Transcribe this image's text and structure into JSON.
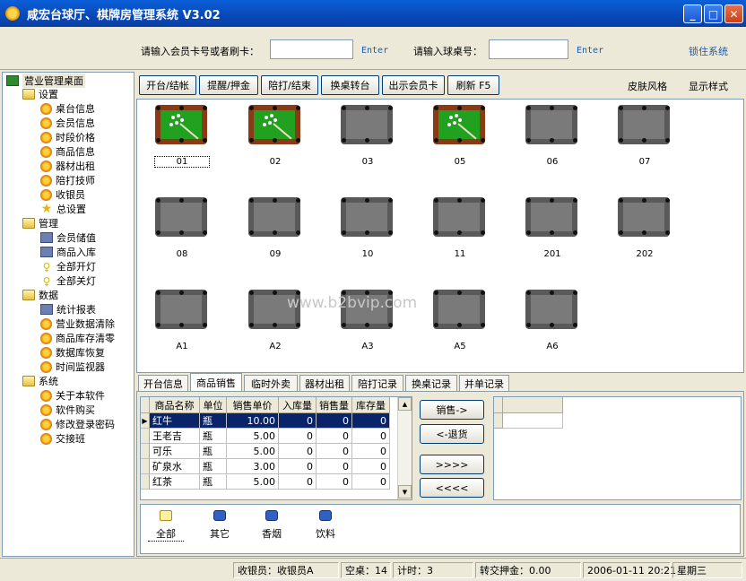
{
  "window": {
    "title": "咸宏台球厅、棋牌房管理系统 V3.02",
    "min": "_",
    "max": "□",
    "close": "✕"
  },
  "topbar": {
    "card_label": "请输入会员卡号或者刷卡：",
    "card_value": "",
    "enter1": "Enter",
    "table_label": "请输入球桌号：",
    "table_value": "",
    "enter2": "Enter",
    "lock": "锁住系统"
  },
  "tree": {
    "root": "营业管理桌面",
    "groups": [
      {
        "label": "设置",
        "items": [
          "桌台信息",
          "会员信息",
          "时段价格",
          "商品信息",
          "器材出租",
          "陪打技师",
          "收银员",
          "总设置"
        ]
      },
      {
        "label": "管理",
        "items": [
          "会员储值",
          "商品入库",
          "全部开灯",
          "全部关灯"
        ]
      },
      {
        "label": "数据",
        "items": [
          "统计报表",
          "营业数据清除",
          "商品库存清零",
          "数据库恢复",
          "时间监视器"
        ]
      },
      {
        "label": "系统",
        "items": [
          "关于本软件",
          "软件购买",
          "修改登录密码",
          "交接班"
        ]
      }
    ]
  },
  "toolbar": {
    "buttons": [
      "开台/结帐",
      "提醒/押金",
      "陪打/结束",
      "换桌转台",
      "出示会员卡",
      "刷新 F5"
    ],
    "links": [
      "皮肤风格",
      "显示样式"
    ]
  },
  "tables": [
    {
      "name": "01",
      "active": true,
      "selected": true
    },
    {
      "name": "02",
      "active": true
    },
    {
      "name": "03",
      "active": false
    },
    {
      "name": "05",
      "active": true
    },
    {
      "name": "06",
      "active": false
    },
    {
      "name": "07",
      "active": false
    },
    {
      "name": "08",
      "active": false
    },
    {
      "name": "09",
      "active": false
    },
    {
      "name": "10",
      "active": false
    },
    {
      "name": "11",
      "active": false
    },
    {
      "name": "201",
      "active": false
    },
    {
      "name": "202",
      "active": false
    },
    {
      "name": "A1",
      "active": false
    },
    {
      "name": "A2",
      "active": false
    },
    {
      "name": "A3",
      "active": false
    },
    {
      "name": "A5",
      "active": false
    },
    {
      "name": "A6",
      "active": false
    }
  ],
  "watermark": "www.b2bvip.com",
  "tabs": [
    "开台信息",
    "商品销售",
    "临时外卖",
    "器材出租",
    "陪打记录",
    "换桌记录",
    "并单记录"
  ],
  "active_tab": 1,
  "goods": {
    "columns": [
      "商品名称",
      "单位",
      "销售单价",
      "入库量",
      "销售量",
      "库存量"
    ],
    "rows": [
      [
        "红牛",
        "瓶",
        "10.00",
        "0",
        "0",
        "0"
      ],
      [
        "王老吉",
        "瓶",
        "5.00",
        "0",
        "0",
        "0"
      ],
      [
        "可乐",
        "瓶",
        "5.00",
        "0",
        "0",
        "0"
      ],
      [
        "矿泉水",
        "瓶",
        "3.00",
        "0",
        "0",
        "0"
      ],
      [
        "红茶",
        "瓶",
        "5.00",
        "0",
        "0",
        "0"
      ]
    ],
    "selected_row": 0
  },
  "actions": [
    "销售->",
    "<-退货",
    ">>>>",
    "<<<<"
  ],
  "categories": [
    "全部",
    "其它",
    "香烟",
    "饮料"
  ],
  "status": {
    "cashier": "收银员：收银员A",
    "empty": "空桌：14",
    "timing": "计时：3",
    "deposit": "转交押金：0.00",
    "datetime": "2006-01-11 20:21",
    "weekday": "星期三"
  }
}
